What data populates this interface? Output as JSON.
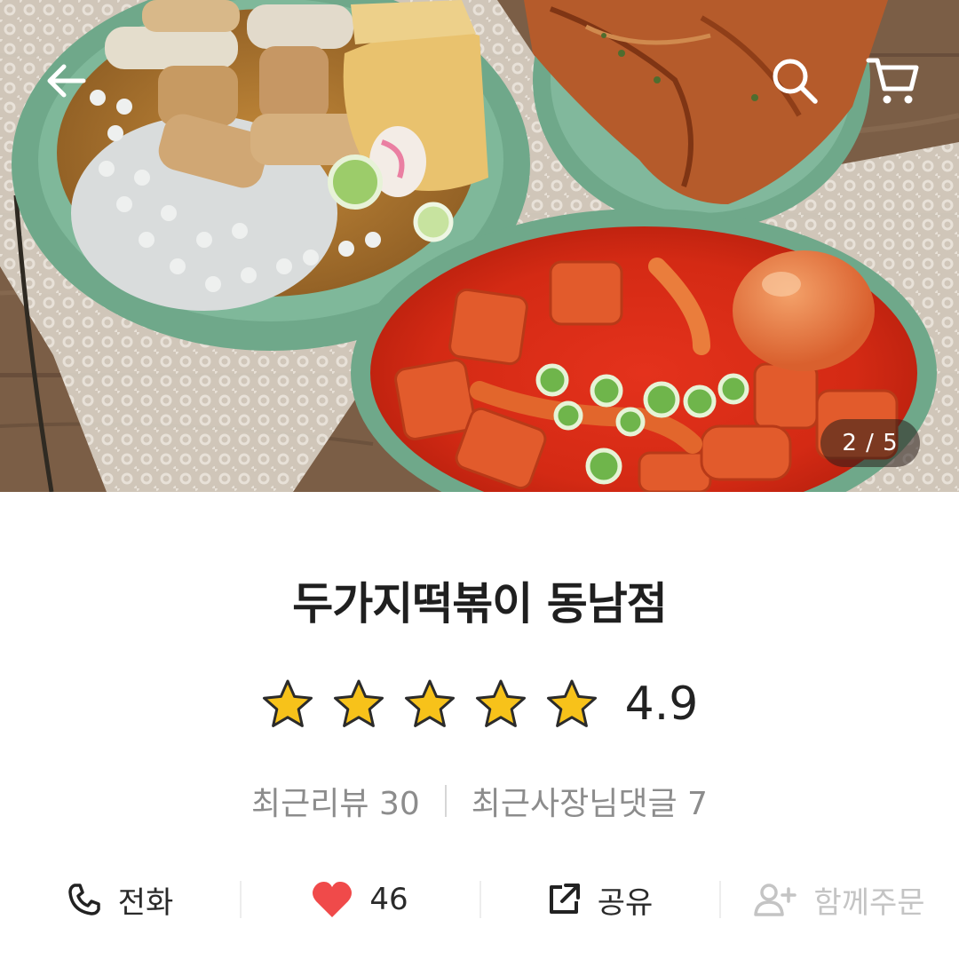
{
  "hero": {
    "image_counter": "2 / 5",
    "icons": {
      "back": "arrow-left-icon",
      "search": "search-icon",
      "cart": "cart-icon"
    }
  },
  "store": {
    "name": "두가지떡볶이 동남점",
    "rating": "4.9",
    "stars_filled": 5,
    "stars_total": 5,
    "recent_reviews_label": "최근리뷰 30",
    "recent_owner_comments_label": "최근사장님댓글 7"
  },
  "actions": {
    "call": {
      "label": "전화",
      "icon": "phone-icon"
    },
    "like": {
      "label": "46",
      "icon": "heart-icon"
    },
    "share": {
      "label": "공유",
      "icon": "share-icon"
    },
    "group_order": {
      "label": "함께주문",
      "icon": "add-person-icon",
      "enabled": false
    }
  },
  "colors": {
    "star": "#f7c21a",
    "heart": "#f04a4a",
    "title": "#1f1f1f",
    "muted": "#8c8c8c"
  }
}
